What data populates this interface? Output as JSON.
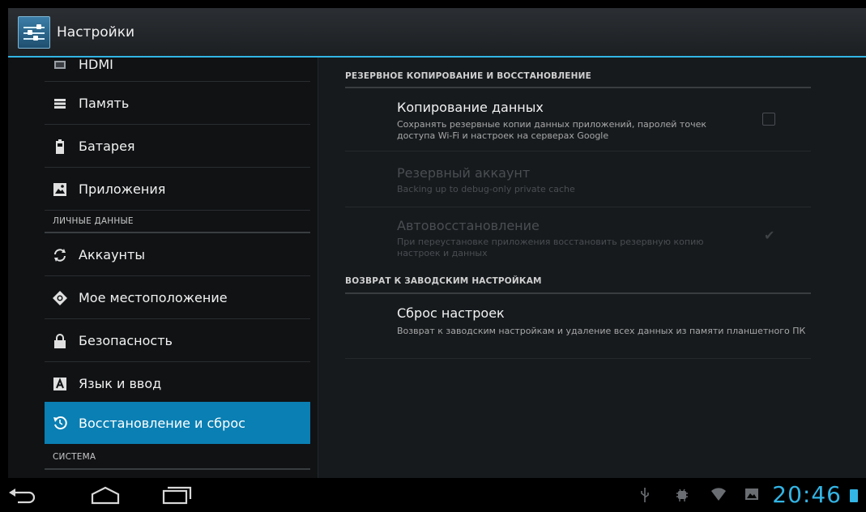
{
  "app": {
    "title": "Настройки"
  },
  "sidebar": {
    "items_top": [
      {
        "label": "HDMI",
        "icon": "hdmi-icon"
      },
      {
        "label": "Память",
        "icon": "storage-icon"
      },
      {
        "label": "Батарея",
        "icon": "battery-icon"
      },
      {
        "label": "Приложения",
        "icon": "apps-icon"
      }
    ],
    "category_personal": "ЛИЧНЫЕ ДАННЫЕ",
    "items_personal": [
      {
        "label": "Аккаунты",
        "icon": "sync-icon"
      },
      {
        "label": "Мое местоположение",
        "icon": "location-icon"
      },
      {
        "label": "Безопасность",
        "icon": "lock-icon"
      },
      {
        "label": "Язык и ввод",
        "icon": "keyboard-icon"
      },
      {
        "label": "Восстановление и сброс",
        "icon": "restore-icon",
        "selected": true
      }
    ],
    "category_system": "СИСТЕМА"
  },
  "content": {
    "backup_header": "РЕЗЕРВНОЕ КОПИРОВАНИЕ И ВОССТАНОВЛЕНИЕ",
    "backup_data": {
      "title": "Копирование данных",
      "summary": "Сохранять резервные копии данных приложений, паролей точек доступа Wi-Fi и настроек на серверах Google",
      "checked": false
    },
    "backup_account": {
      "title": "Резервный аккаунт",
      "summary": "Backing up to debug-only private cache",
      "enabled": false
    },
    "auto_restore": {
      "title": "Автовосстановление",
      "summary": "При переустановке приложения восстановить резервную копию настроек и данных",
      "checked": true,
      "enabled": false
    },
    "factory_header": "ВОЗВРАТ К ЗАВОДСКИМ НАСТРОЙКАМ",
    "factory_reset": {
      "title": "Сброс настроек",
      "summary": "Возврат к заводским настройкам и удаление всех данных из памяти планшетного ПК"
    }
  },
  "status_bar": {
    "time": "20:46",
    "icons": [
      "usb-icon",
      "debug-icon",
      "wifi-icon",
      "screenshot-icon",
      "battery-status-icon"
    ]
  },
  "colors": {
    "accent": "#33b5e5",
    "selected": "#0a7fb3",
    "background": "#101214"
  }
}
